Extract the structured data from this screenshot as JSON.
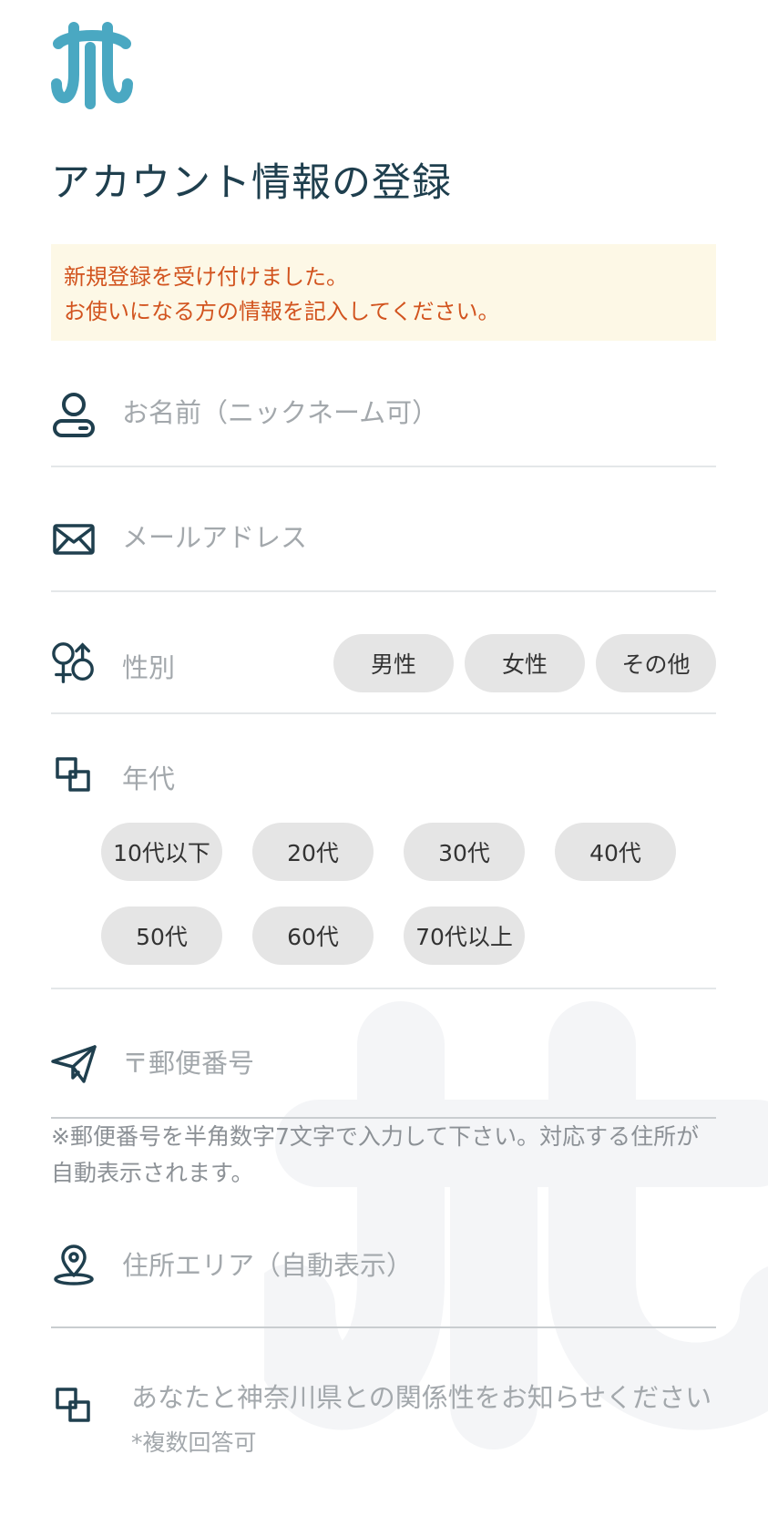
{
  "brand": {
    "color": "#4aa8c2",
    "logo": "kanagawa-logo"
  },
  "title": "アカウント情報の登録",
  "notice": {
    "line1": "新規登録を受け付けました。",
    "line2": "お使いになる方の情報を記入してください。",
    "bg": "#fdf8e6",
    "text_color": "#d2541f"
  },
  "fields": {
    "name": {
      "placeholder": "お名前（ニックネーム可）",
      "icon": "user-icon"
    },
    "email": {
      "placeholder": "メールアドレス",
      "icon": "mail-icon"
    },
    "gender": {
      "label": "性別",
      "icon": "gender-icon",
      "options": [
        "男性",
        "女性",
        "その他"
      ]
    },
    "age": {
      "label": "年代",
      "icon": "copy-icon",
      "options": [
        "10代以下",
        "20代",
        "30代",
        "40代",
        "50代",
        "60代",
        "70代以上"
      ]
    },
    "postal": {
      "placeholder": "〒郵便番号",
      "icon": "send-icon",
      "note": "※郵便番号を半角数字7文字で入力して下さい。対応する住所が自動表示されます。"
    },
    "area": {
      "placeholder": "住所エリア（自動表示）",
      "icon": "location-pin-icon"
    },
    "relation": {
      "label": "あなたと神奈川県との関係性をお知らせください",
      "sub": "*複数回答可",
      "icon": "copy-icon"
    }
  }
}
